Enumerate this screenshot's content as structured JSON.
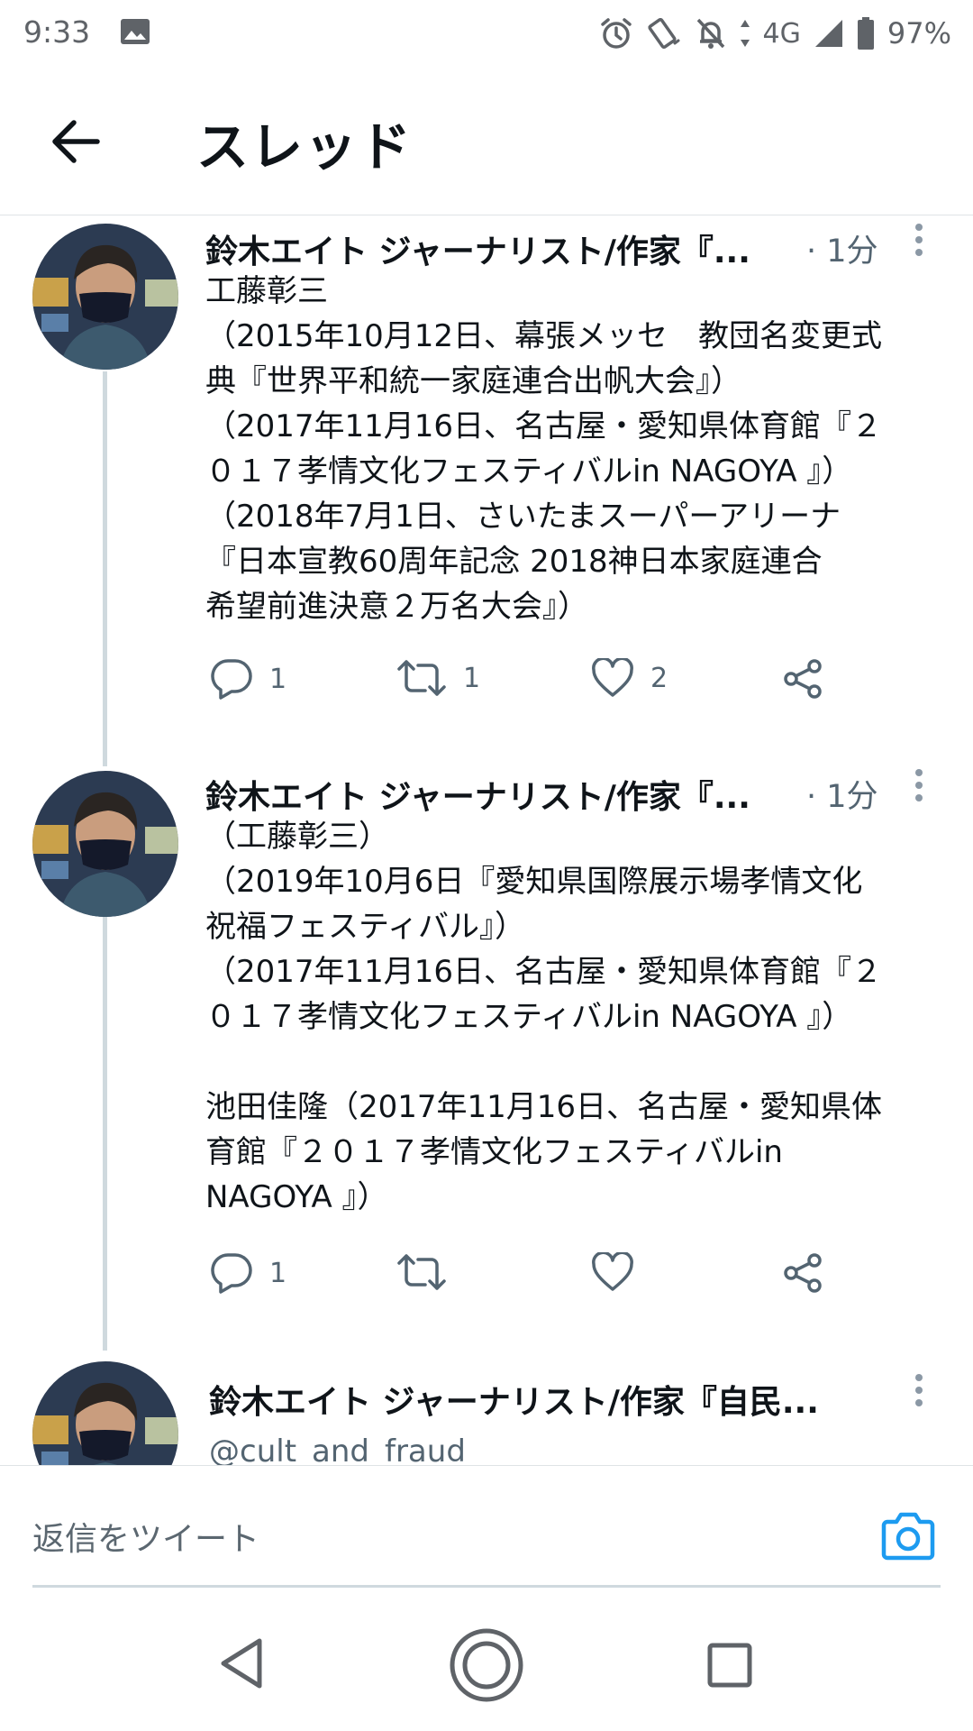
{
  "status_bar": {
    "time": "9:33",
    "network": "4G",
    "battery": "97%",
    "icons": [
      "image-icon",
      "alarm-icon",
      "vibrate-icon",
      "dnd-bell-off-icon",
      "signal-icon",
      "battery-icon"
    ]
  },
  "header": {
    "title": "スレッド",
    "back_icon": "arrow-left-icon"
  },
  "tweets": [
    {
      "name": "鈴木エイト ジャーナリスト/作家『...",
      "time": "· 1分",
      "lines": [
        "工藤彰三",
        "（2015年10月12日、幕張メッセ　教団名変更式",
        "典『世界平和統一家庭連合出帆大会』）",
        "（2017年11月16日、名古屋・愛知県体育館『２",
        "０１７孝情文化フェスティバルin NAGOYA 』）",
        "（2018年7月1日、さいたまスーパーアリーナ",
        "『日本宣教60周年記念 2018神日本家庭連合",
        "希望前進決意２万名大会』）"
      ],
      "reply_count": "1",
      "retweet_count": "1",
      "like_count": "2"
    },
    {
      "name": "鈴木エイト ジャーナリスト/作家『...",
      "time": "· 1分",
      "lines": [
        "（工藤彰三）",
        "（2019年10月6日『愛知県国際展示場孝情文化",
        "祝福フェスティバル』）",
        "（2017年11月16日、名古屋・愛知県体育館『２",
        "０１７孝情文化フェスティバルin NAGOYA 』）",
        "",
        "池田佳隆（2017年11月16日、名古屋・愛知県体",
        "育館『２０１７孝情文化フェスティバルin",
        "NAGOYA 』）"
      ],
      "reply_count": "1",
      "retweet_count": "",
      "like_count": ""
    },
    {
      "name": "鈴木エイト ジャーナリスト/作家『自民...",
      "handle": "@cult_and_fraud"
    }
  ],
  "reply_bar": {
    "placeholder": "返信をツイート",
    "camera_icon": "camera-icon"
  },
  "colors": {
    "text": "#0f1419",
    "secondary": "#536471",
    "accent": "#1d9bf0",
    "thread_line": "#cfd9de"
  }
}
